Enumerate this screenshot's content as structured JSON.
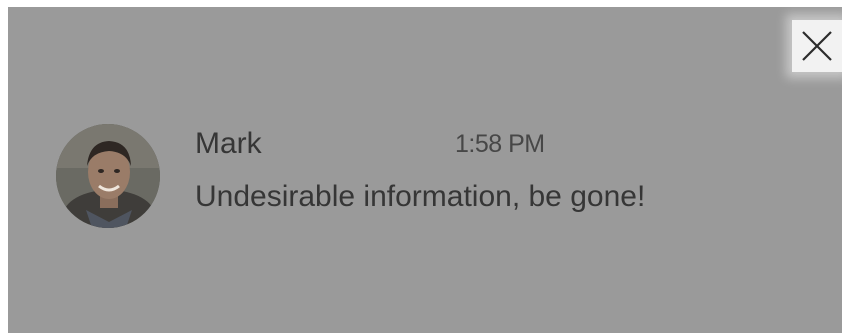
{
  "notification": {
    "author": "Mark",
    "timestamp": "1:58 PM",
    "message": "Undesirable information, be gone!",
    "avatar_icon": "user-photo",
    "close_icon": "close-icon"
  },
  "colors": {
    "overlay": "#9a9a9a",
    "text": "#363636",
    "close_button_bg": "#f2f2f2"
  }
}
